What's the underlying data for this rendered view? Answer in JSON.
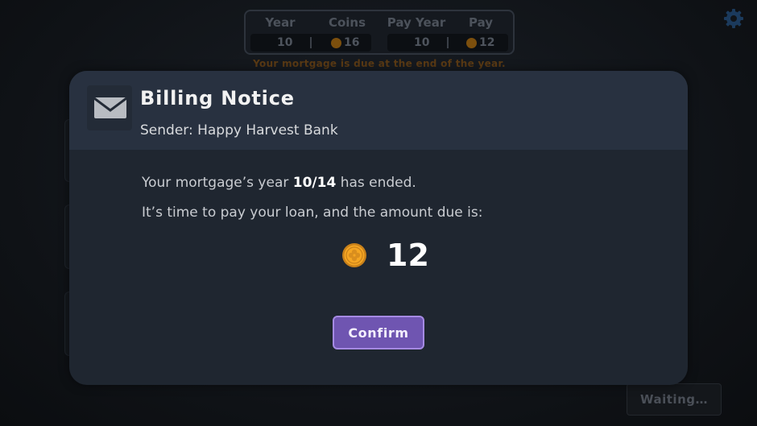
{
  "hud": {
    "year_label": "Year",
    "coins_label": "Coins",
    "pay_year_label": "Pay Year",
    "pay_label": "Pay",
    "year_value": "10",
    "coins_value": "16",
    "pay_year_value": "10",
    "pay_value": "12",
    "notice": "Your mortgage is due at the end of the year."
  },
  "modal": {
    "title": "Billing Notice",
    "sender": "Sender: Happy Harvest Bank",
    "line1_prefix": "Your mortgage’s year ",
    "line1_year": "10/14",
    "line1_suffix": " has ended.",
    "line2": "It’s time to pay your loan, and the amount due is:",
    "amount": "12",
    "confirm_label": "Confirm"
  },
  "waiting_label": "Waiting…",
  "icons": {
    "mail": "mail-icon",
    "coin": "coin-icon",
    "settings": "gear-icon"
  },
  "colors": {
    "accent": "#6f55b1",
    "coin": "#f5a623",
    "modal_bg": "#1f2630"
  }
}
